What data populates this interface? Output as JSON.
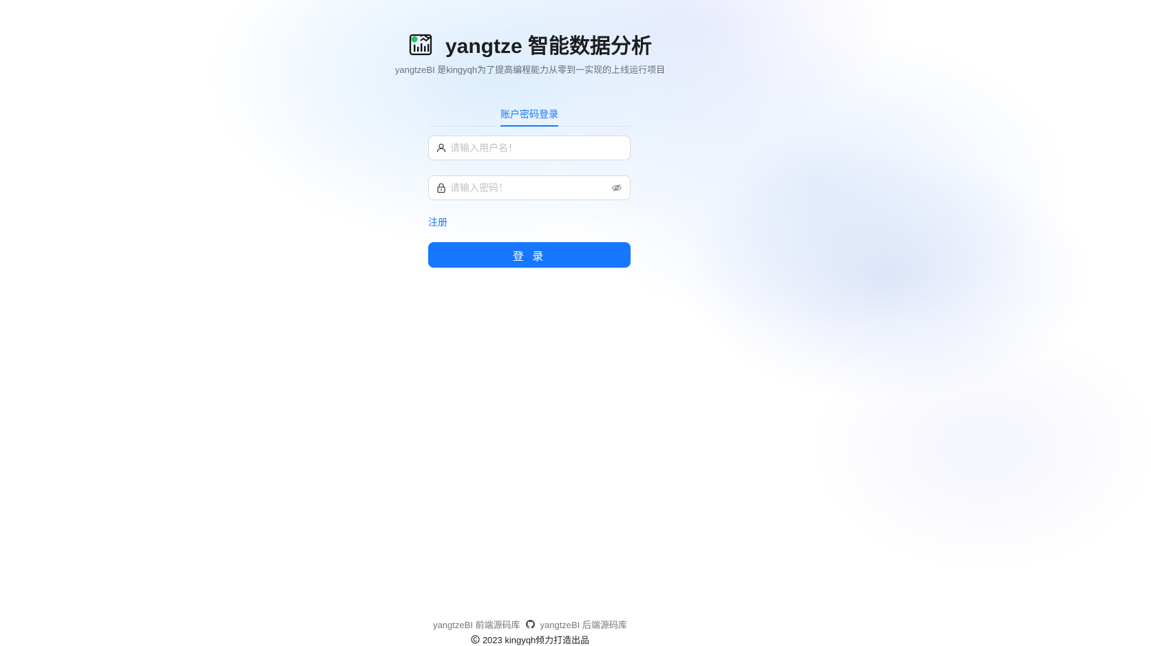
{
  "header": {
    "title": "yangtze 智能数据分析",
    "subtitle": "yangtzeBI 是kingyqh为了提高编程能力从零到一实现的上线运行项目",
    "logo_icon": "chart-logo-icon"
  },
  "login": {
    "tab_label": "账户密码登录",
    "username_placeholder": "请输入用户名！",
    "password_placeholder": "请输入密码！",
    "register_label": "注册",
    "login_button_label": "登 录"
  },
  "footer": {
    "frontend_link": "yangtzeBI 前端源码库",
    "backend_link": "yangtzeBI 后端源码库",
    "copyright": "2023 kingyqh倾力打造出品"
  },
  "colors": {
    "primary": "#1677ff",
    "border": "#d9d9d9"
  }
}
